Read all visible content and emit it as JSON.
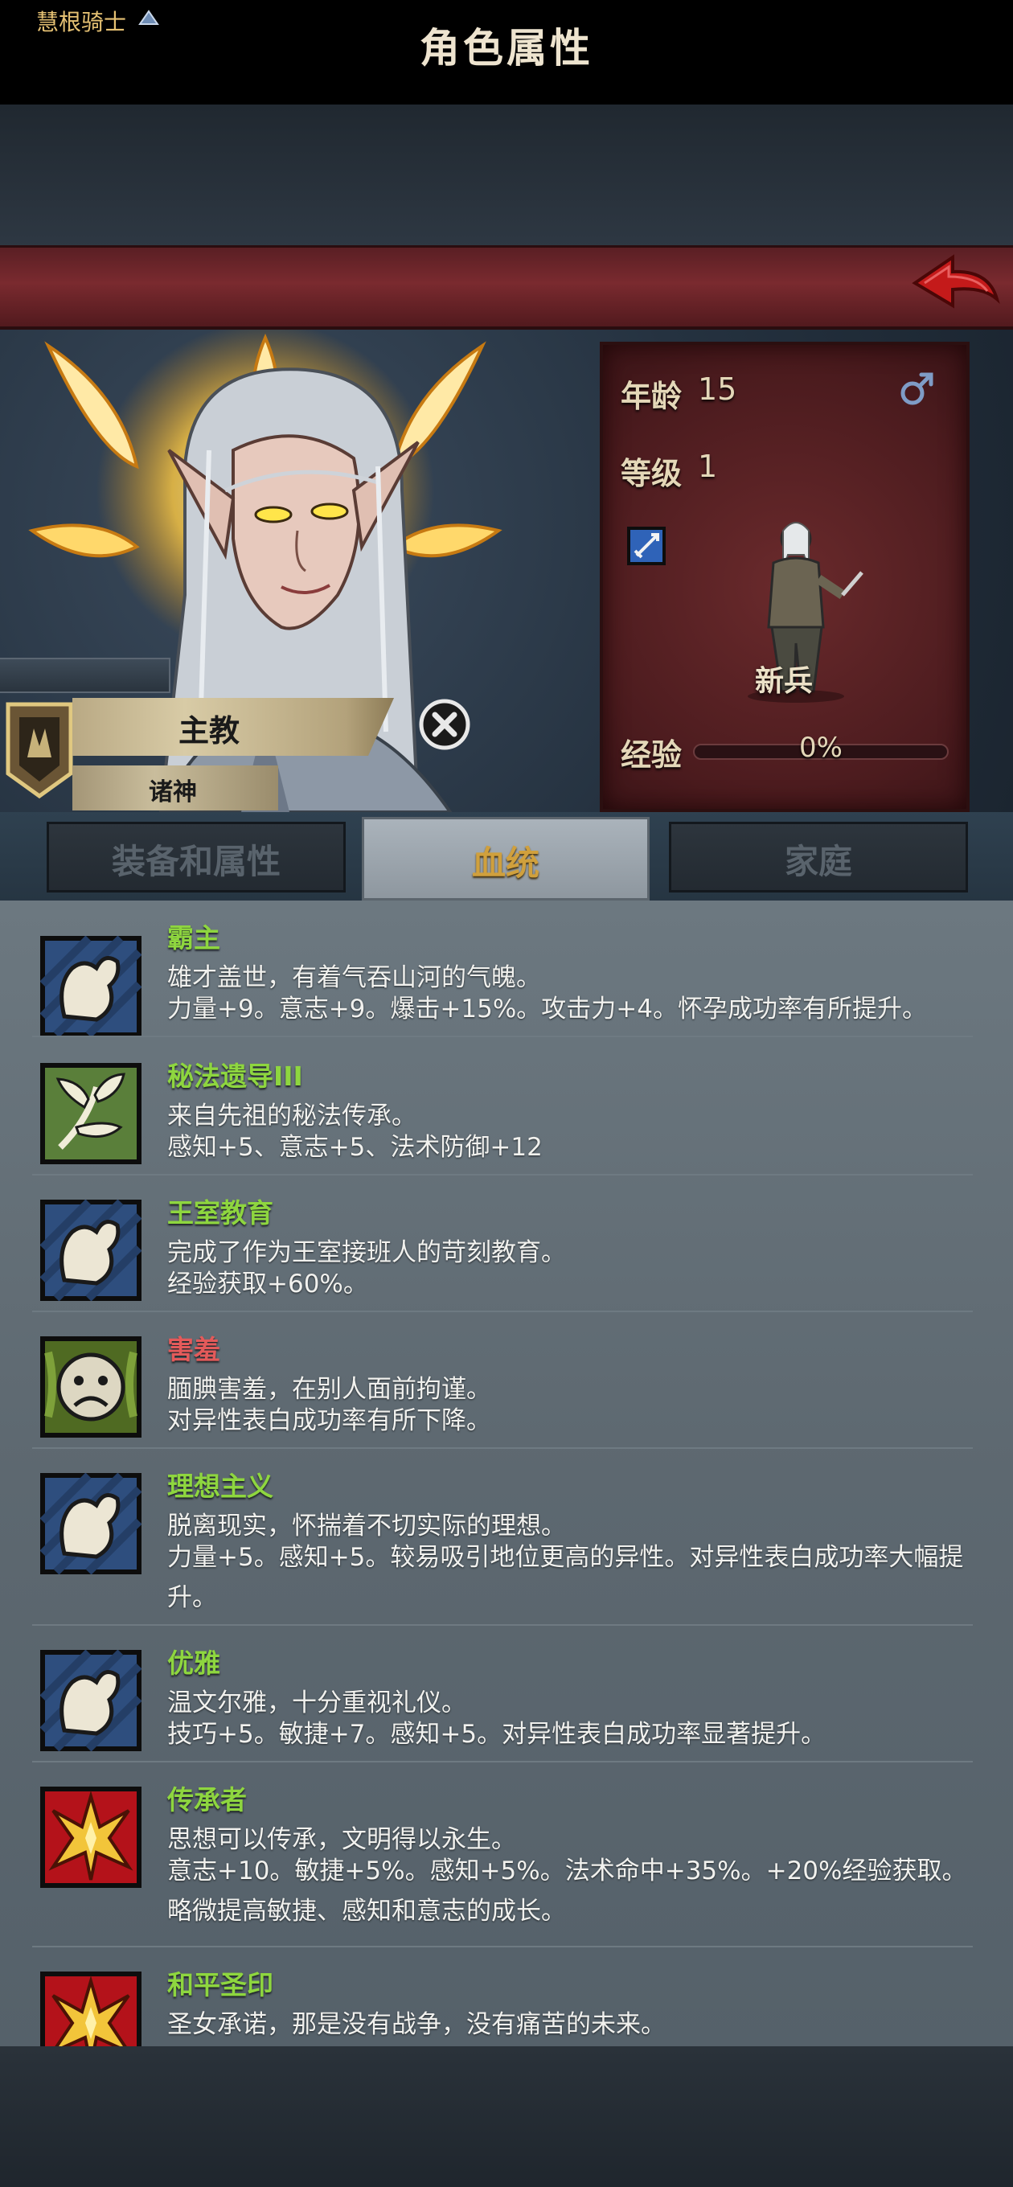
{
  "header": {
    "title": "角色属性"
  },
  "hero": {
    "class_tag": "慧根骑士",
    "rank": "主教",
    "deity": "诸神"
  },
  "stats": {
    "age_label": "年龄",
    "age_value": "15",
    "level_label": "等级",
    "level_value": "1",
    "soldier_label": "新兵",
    "exp_label": "经验",
    "exp_value": "0%",
    "exp_fraction": 0
  },
  "tabs": [
    {
      "label": "装备和属性",
      "active": false
    },
    {
      "label": "血统",
      "active": true
    },
    {
      "label": "家庭",
      "active": false
    }
  ],
  "traits": [
    {
      "name": "霸主",
      "name_color": "#8ed63f",
      "icon": "arm-icon",
      "desc": "雄才盖世，有着气吞山河的气魄。",
      "effect": "力量+9。意志+9。爆击+15%。攻击力+4。怀孕成功率有所提升。"
    },
    {
      "name": "秘法遗导III",
      "name_color": "#8ed63f",
      "icon": "leaf-icon",
      "desc": "来自先祖的秘法传承。",
      "effect": "感知+5、意志+5、法术防御+12"
    },
    {
      "name": "王室教育",
      "name_color": "#8ed63f",
      "icon": "arm-icon",
      "desc": "完成了作为王室接班人的苛刻教育。",
      "effect": "经验获取+60%。"
    },
    {
      "name": "害羞",
      "name_color": "#e45a5a",
      "icon": "sad-face-icon",
      "desc": "腼腆害羞，在别人面前拘谨。",
      "effect": "对异性表白成功率有所下降。"
    },
    {
      "name": "理想主义",
      "name_color": "#8ed63f",
      "icon": "arm-icon",
      "desc": "脱离现实，怀揣着不切实际的理想。",
      "effect": "力量+5。感知+5。较易吸引地位更高的异性。对异性表白成功率大幅提升。"
    },
    {
      "name": "优雅",
      "name_color": "#8ed63f",
      "icon": "arm-icon",
      "desc": "温文尔雅，十分重视礼仪。",
      "effect": "技巧+5。敏捷+7。感知+5。对异性表白成功率显著提升。"
    },
    {
      "name": "传承者",
      "name_color": "#8ed63f",
      "icon": "golden-crest-icon",
      "desc": "思想可以传承，文明得以永生。",
      "effect": "意志+10。敏捷+5%。感知+5%。法术命中+35%。+20%经验获取。略微提高敏捷、感知和意志的成长。"
    },
    {
      "name": "和平圣印",
      "name_color": "#8ed63f",
      "icon": "golden-crest-icon",
      "desc": "圣女承诺，那是没有战争，没有痛苦的未来。",
      "effect": ""
    }
  ]
}
